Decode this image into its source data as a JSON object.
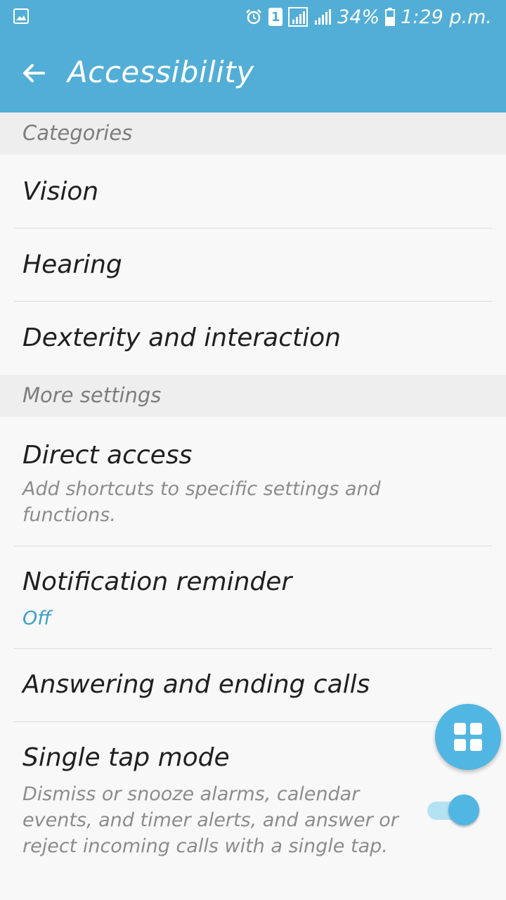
{
  "status_bar": {
    "battery": "34%",
    "time": "1:29 p.m.",
    "sim_badge": "1",
    "left_icon": "image-icon",
    "icons": [
      "alarm-icon",
      "sim-icon",
      "signal-icon",
      "signal-icon",
      "battery-icon"
    ]
  },
  "app_bar": {
    "title": "Accessibility",
    "back_icon": "arrow-left-icon",
    "color": "#52aed6"
  },
  "sections": {
    "categories": "Categories",
    "more_settings": "More settings"
  },
  "categories": [
    {
      "label": "Vision"
    },
    {
      "label": "Hearing"
    },
    {
      "label": "Dexterity and interaction"
    }
  ],
  "more": {
    "direct_access": {
      "title": "Direct access",
      "summary": "Add shortcuts to specific settings and functions."
    },
    "notification_reminder": {
      "title": "Notification reminder",
      "value": "Off"
    },
    "answering_calls": {
      "title": "Answering and ending calls"
    },
    "single_tap": {
      "title": "Single tap mode",
      "summary": "Dismiss or snooze alarms, calendar events, and timer alerts, and answer or reject incoming calls with a single tap.",
      "enabled": true
    }
  },
  "fab": {
    "icon": "apps-grid-icon",
    "color": "#52b6e2"
  }
}
